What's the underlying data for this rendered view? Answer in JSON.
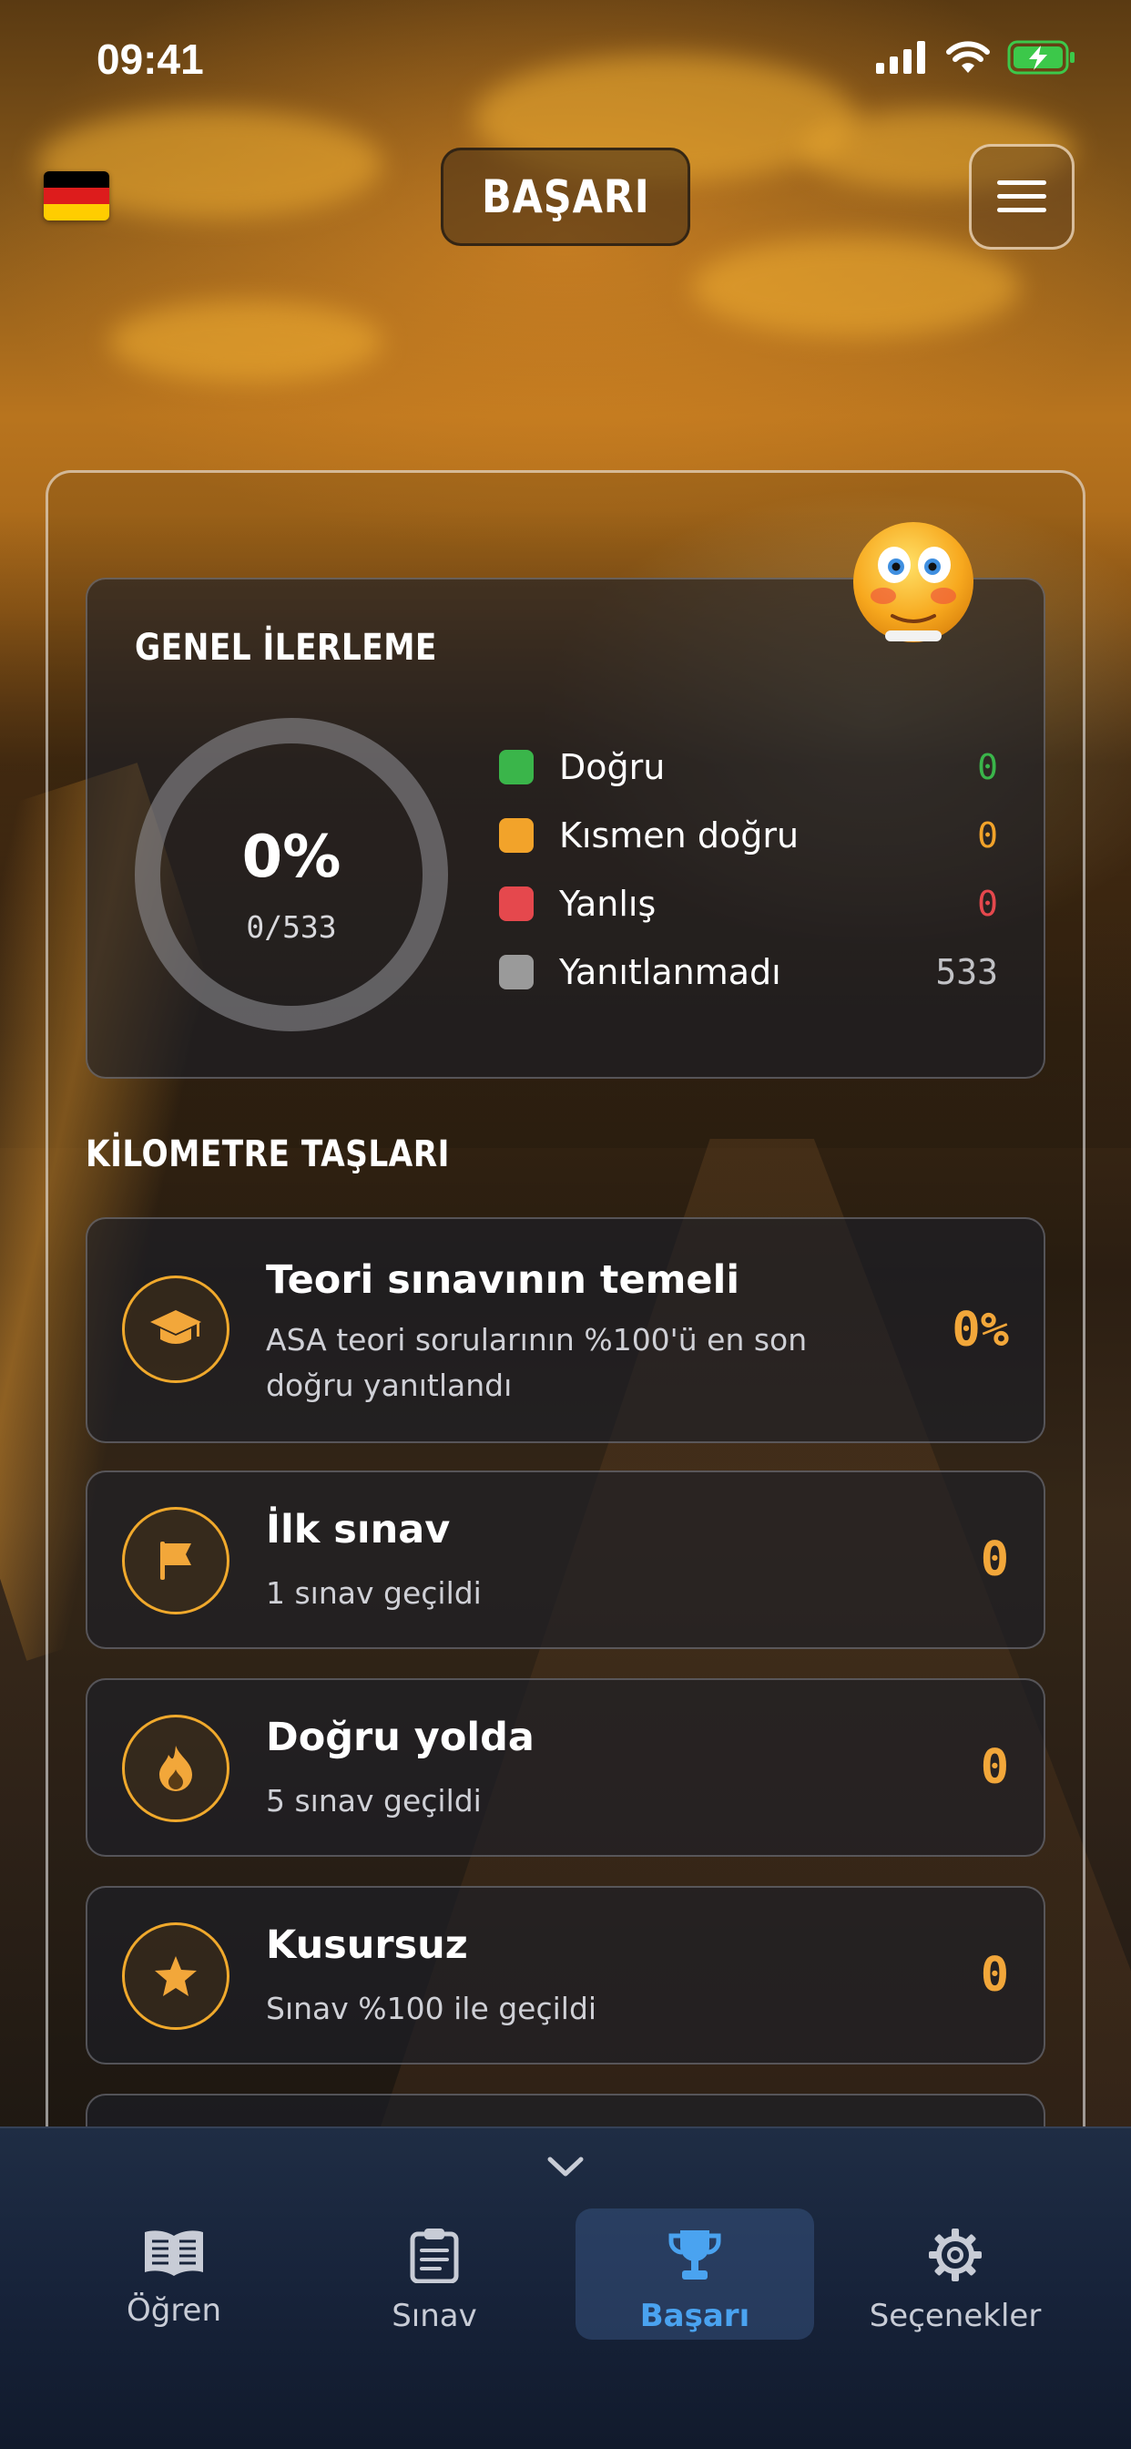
{
  "status_bar": {
    "time": "09:41"
  },
  "header": {
    "title": "BAŞARI",
    "flag": "germany-flag",
    "menu_icon": "hamburger-menu-icon"
  },
  "overall_progress": {
    "heading": "GENEL İLERLEME",
    "percent": "0%",
    "fraction": "0/533",
    "legend": [
      {
        "label": "Doğru",
        "value": "0",
        "color": "#3ab54a"
      },
      {
        "label": "Kısmen doğru",
        "value": "0",
        "color": "#f2a32a"
      },
      {
        "label": "Yanlış",
        "value": "0",
        "color": "#e5484d"
      },
      {
        "label": "Yanıtlanmadı",
        "value": "533",
        "color": "#9a9a9a"
      }
    ]
  },
  "milestones_title": "KİLOMETRE TAŞLARI",
  "milestones": [
    {
      "icon": "graduation-cap-icon",
      "title": "Teori sınavının temeli",
      "desc": "ASA teori sorularının %100'ü en son doğru yanıtlandı",
      "value": "0%"
    },
    {
      "icon": "flag-icon",
      "title": "İlk sınav",
      "desc": "1 sınav geçildi",
      "value": "0"
    },
    {
      "icon": "flame-icon",
      "title": "Doğru yolda",
      "desc": "5 sınav geçildi",
      "value": "0"
    },
    {
      "icon": "star-icon",
      "title": "Kusursuz",
      "desc": "Sınav %100 ile geçildi",
      "value": "0"
    }
  ],
  "nav": {
    "tabs": [
      {
        "icon": "book-icon",
        "label": "Öğren"
      },
      {
        "icon": "clipboard-icon",
        "label": "Sınav"
      },
      {
        "icon": "trophy-icon",
        "label": "Başarı",
        "active": true
      },
      {
        "icon": "gear-icon",
        "label": "Seçenekler"
      }
    ]
  },
  "colors": {
    "accent": "#f2a73a",
    "nav_active": "#4aa3f0"
  }
}
